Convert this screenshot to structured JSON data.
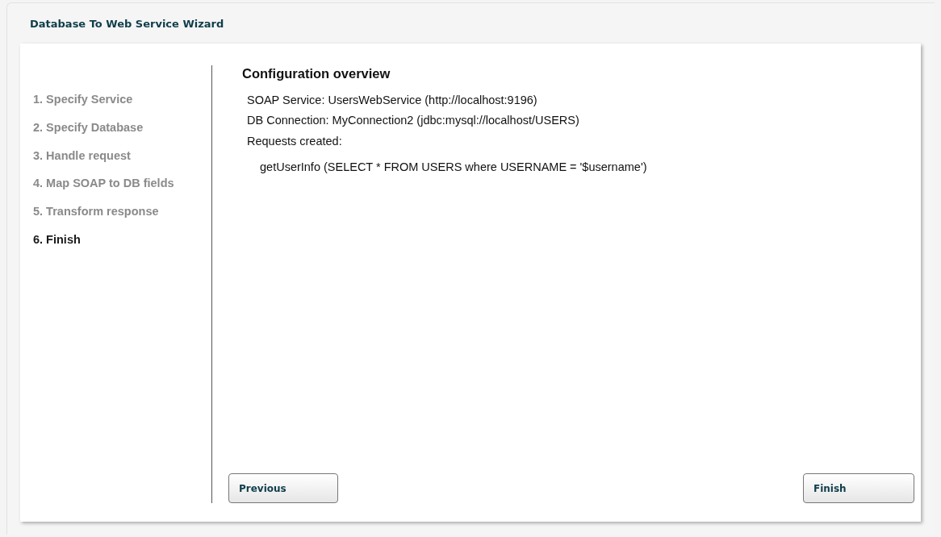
{
  "window": {
    "title": "Database To Web Service Wizard"
  },
  "steps": [
    {
      "label": "1. Specify Service",
      "selected": false
    },
    {
      "label": "2. Specify Database",
      "selected": false
    },
    {
      "label": "3. Handle request",
      "selected": false
    },
    {
      "label": "4. Map SOAP to DB fields",
      "selected": false
    },
    {
      "label": "5. Transform response",
      "selected": false
    },
    {
      "label": "6. Finish",
      "selected": true
    }
  ],
  "overview": {
    "heading": "Configuration overview",
    "lines": [
      "SOAP Service: UsersWebService (http://localhost:9196)",
      "DB Connection: MyConnection2 (jdbc:mysql://localhost/USERS)",
      "Requests created:"
    ],
    "requests": [
      "getUserInfo (SELECT * FROM USERS where USERNAME = '$username')"
    ]
  },
  "buttons": {
    "previous": "Previous",
    "finish": "Finish"
  }
}
